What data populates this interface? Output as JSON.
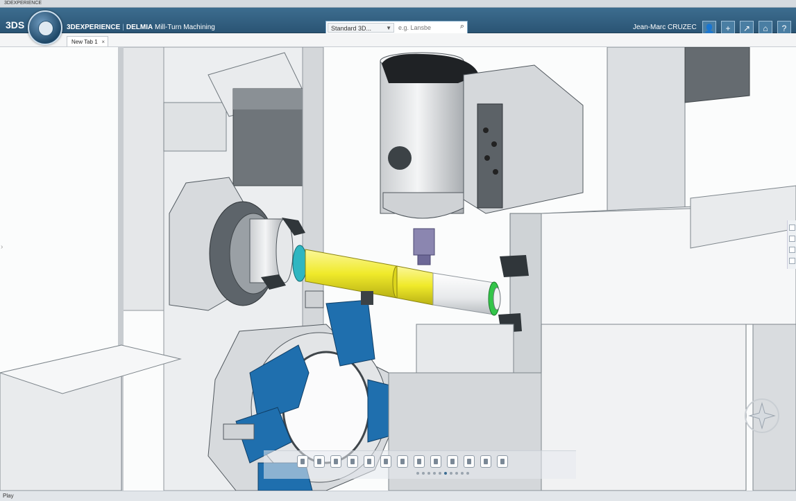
{
  "window": {
    "title": "3DEXPERIENCE"
  },
  "topbar": {
    "brand": "3DS",
    "app_brand": "3DEXPERIENCE",
    "app_product": "DELMIA",
    "app_name": "Mill-Turn Machining",
    "search": {
      "scope": "Standard 3D...",
      "placeholder": "e.g. Lansbe"
    },
    "user": "Jean-Marc CRUZEC",
    "buttons": [
      "profile-icon",
      "add-icon",
      "share-icon",
      "home-icon",
      "help-icon"
    ]
  },
  "tabs": [
    {
      "label": "New Tab 1"
    }
  ],
  "status": {
    "text": "Play"
  },
  "colors": {
    "topbar": "#2f5b7c",
    "workpiece": "#f0ea2a",
    "turret": "#1f6fae",
    "chuck_ring": "#2fb6c1",
    "green_ring": "#34c54a"
  }
}
